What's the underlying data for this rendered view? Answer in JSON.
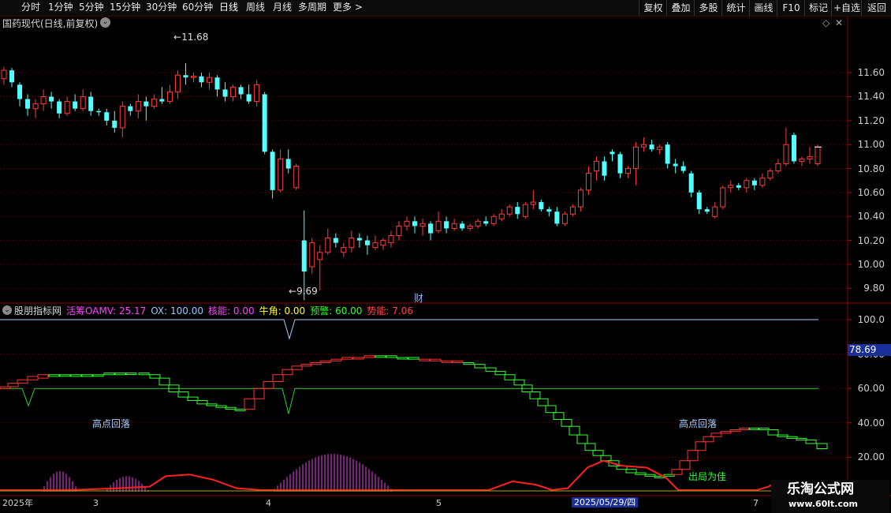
{
  "toolbar": {
    "left_items": [
      "分时",
      "1分钟",
      "5分钟",
      "15分钟",
      "30分钟",
      "60分钟",
      "日线",
      "周线",
      "月线",
      "多周期",
      "更多 >"
    ],
    "active_item": "日线",
    "right_items": [
      "复权",
      "叠加",
      "多股",
      "统计",
      "画线",
      "F10",
      "标记",
      "+自选",
      "返回"
    ]
  },
  "price_panel": {
    "title": "国药现代(日线,前复权)",
    "high_label": "11.68",
    "low_label": "9.69",
    "event_marker": "财",
    "axis_ticks": [
      "11.60",
      "11.40",
      "11.20",
      "11.00",
      "10.80",
      "10.60",
      "10.40",
      "10.20",
      "10.00",
      "9.80"
    ]
  },
  "indicator_panel": {
    "name": "股朋指标网",
    "readouts": [
      {
        "label": "活筹OAMV:",
        "value": "25.17",
        "color": "#ff44ff"
      },
      {
        "label": "OX:",
        "value": "100.00",
        "color": "#99c8ff"
      },
      {
        "label": "核能:",
        "value": "0.00",
        "color": "#ff44ff"
      },
      {
        "label": "牛角:",
        "value": "0.00",
        "color": "#ffff33"
      },
      {
        "label": "预警:",
        "value": "60.00",
        "color": "#33ff33"
      },
      {
        "label": "势能:",
        "value": "7.06",
        "color": "#ff4444"
      }
    ],
    "axis_ticks": [
      "100.0",
      "80.00",
      "60.00",
      "40.00",
      "20.00"
    ],
    "current_value": "78.69",
    "annotations": [
      "高点回落",
      "高点回落",
      "出局为佳"
    ]
  },
  "date_axis": {
    "labels": [
      "2025年",
      "3",
      "4",
      "5",
      "7"
    ],
    "cursor_date": "2025/05/29/四"
  },
  "watermark": {
    "line1": "乐淘公式网",
    "line2": "www.60lt.com"
  },
  "colors": {
    "up": "#ff3c3c",
    "down": "#54ffff",
    "bg": "#000000",
    "grid": "#5a0000"
  },
  "chart_data": {
    "type": "candlestick",
    "title": "国药现代(日线,前复权)",
    "ylim": [
      9.69,
      11.72
    ],
    "candles": [
      [
        11.55,
        11.65,
        11.5,
        11.62
      ],
      [
        11.62,
        11.64,
        11.48,
        11.52
      ],
      [
        11.5,
        11.52,
        11.32,
        11.38
      ],
      [
        11.38,
        11.42,
        11.24,
        11.3
      ],
      [
        11.3,
        11.38,
        11.22,
        11.34
      ],
      [
        11.34,
        11.46,
        11.28,
        11.4
      ],
      [
        11.4,
        11.44,
        11.3,
        11.36
      ],
      [
        11.36,
        11.38,
        11.22,
        11.26
      ],
      [
        11.26,
        11.4,
        11.24,
        11.36
      ],
      [
        11.36,
        11.42,
        11.28,
        11.3
      ],
      [
        11.3,
        11.46,
        11.28,
        11.4
      ],
      [
        11.4,
        11.44,
        11.24,
        11.28
      ],
      [
        11.28,
        11.3,
        11.24,
        11.27
      ],
      [
        11.27,
        11.3,
        11.16,
        11.2
      ],
      [
        11.2,
        11.28,
        11.1,
        11.14
      ],
      [
        11.14,
        11.36,
        11.06,
        11.32
      ],
      [
        11.32,
        11.34,
        11.24,
        11.28
      ],
      [
        11.28,
        11.42,
        11.22,
        11.36
      ],
      [
        11.36,
        11.4,
        11.2,
        11.32
      ],
      [
        11.32,
        11.42,
        11.3,
        11.38
      ],
      [
        11.38,
        11.48,
        11.34,
        11.36
      ],
      [
        11.36,
        11.5,
        11.34,
        11.44
      ],
      [
        11.44,
        11.62,
        11.38,
        11.58
      ],
      [
        11.58,
        11.68,
        11.5,
        11.56
      ],
      [
        11.56,
        11.6,
        11.52,
        11.57
      ],
      [
        11.57,
        11.6,
        11.48,
        11.52
      ],
      [
        11.52,
        11.6,
        11.46,
        11.56
      ],
      [
        11.56,
        11.58,
        11.4,
        11.46
      ],
      [
        11.46,
        11.52,
        11.36,
        11.4
      ],
      [
        11.4,
        11.5,
        11.36,
        11.48
      ],
      [
        11.48,
        11.5,
        11.38,
        11.42
      ],
      [
        11.42,
        11.5,
        11.34,
        11.36
      ],
      [
        11.36,
        11.54,
        11.32,
        11.5
      ],
      [
        11.42,
        11.44,
        10.92,
        10.94
      ],
      [
        10.94,
        10.96,
        10.55,
        10.62
      ],
      [
        10.62,
        10.96,
        10.6,
        10.88
      ],
      [
        10.88,
        10.96,
        10.76,
        10.8
      ],
      [
        10.64,
        10.84,
        10.62,
        10.82
      ],
      [
        10.2,
        10.45,
        9.7,
        9.94
      ],
      [
        9.98,
        10.22,
        9.92,
        10.18
      ],
      [
        10.04,
        10.16,
        9.78,
        10.1
      ],
      [
        10.1,
        10.3,
        10.08,
        10.22
      ],
      [
        10.22,
        10.26,
        10.14,
        10.18
      ],
      [
        10.1,
        10.18,
        10.06,
        10.14
      ],
      [
        10.14,
        10.28,
        10.1,
        10.22
      ],
      [
        10.22,
        10.26,
        10.14,
        10.2
      ],
      [
        10.2,
        10.24,
        10.08,
        10.16
      ],
      [
        10.14,
        10.24,
        10.12,
        10.18
      ],
      [
        10.16,
        10.22,
        10.12,
        10.2
      ],
      [
        10.18,
        10.28,
        10.14,
        10.24
      ],
      [
        10.24,
        10.36,
        10.2,
        10.32
      ],
      [
        10.32,
        10.4,
        10.28,
        10.36
      ],
      [
        10.36,
        10.4,
        10.26,
        10.32
      ],
      [
        10.32,
        10.38,
        10.24,
        10.34
      ],
      [
        10.34,
        10.36,
        10.2,
        10.26
      ],
      [
        10.28,
        10.44,
        10.26,
        10.36
      ],
      [
        10.36,
        10.4,
        10.26,
        10.3
      ],
      [
        10.3,
        10.38,
        10.28,
        10.34
      ],
      [
        10.34,
        10.36,
        10.28,
        10.3
      ],
      [
        10.3,
        10.34,
        10.28,
        10.32
      ],
      [
        10.32,
        10.38,
        10.3,
        10.36
      ],
      [
        10.36,
        10.4,
        10.32,
        10.34
      ],
      [
        10.34,
        10.42,
        10.32,
        10.4
      ],
      [
        10.38,
        10.46,
        10.36,
        10.42
      ],
      [
        10.42,
        10.5,
        10.4,
        10.48
      ],
      [
        10.48,
        10.52,
        10.38,
        10.42
      ],
      [
        10.4,
        10.52,
        10.38,
        10.5
      ],
      [
        10.5,
        10.62,
        10.46,
        10.52
      ],
      [
        10.52,
        10.54,
        10.44,
        10.46
      ],
      [
        10.46,
        10.48,
        10.4,
        10.44
      ],
      [
        10.44,
        10.48,
        10.32,
        10.34
      ],
      [
        10.34,
        10.44,
        10.32,
        10.42
      ],
      [
        10.42,
        10.5,
        10.4,
        10.48
      ],
      [
        10.48,
        10.64,
        10.44,
        10.62
      ],
      [
        10.62,
        10.82,
        10.58,
        10.76
      ],
      [
        10.78,
        10.9,
        10.7,
        10.86
      ],
      [
        10.86,
        10.9,
        10.7,
        10.74
      ],
      [
        10.94,
        10.96,
        10.86,
        10.92
      ],
      [
        10.92,
        10.94,
        10.72,
        10.76
      ],
      [
        10.76,
        10.82,
        10.72,
        10.8
      ],
      [
        10.8,
        11.02,
        10.66,
        10.98
      ],
      [
        10.98,
        11.06,
        10.94,
        11.0
      ],
      [
        11.0,
        11.04,
        10.94,
        10.96
      ],
      [
        10.96,
        11.0,
        10.92,
        10.98
      ],
      [
        11.0,
        11.02,
        10.8,
        10.84
      ],
      [
        10.84,
        10.88,
        10.76,
        10.82
      ],
      [
        10.82,
        10.86,
        10.76,
        10.78
      ],
      [
        10.76,
        10.78,
        10.56,
        10.6
      ],
      [
        10.6,
        10.62,
        10.42,
        10.46
      ],
      [
        10.46,
        10.48,
        10.42,
        10.44
      ],
      [
        10.4,
        10.52,
        10.38,
        10.48
      ],
      [
        10.48,
        10.66,
        10.46,
        10.64
      ],
      [
        10.64,
        10.7,
        10.6,
        10.66
      ],
      [
        10.66,
        10.68,
        10.62,
        10.64
      ],
      [
        10.64,
        10.72,
        10.6,
        10.7
      ],
      [
        10.7,
        10.72,
        10.62,
        10.66
      ],
      [
        10.66,
        10.76,
        10.64,
        10.72
      ],
      [
        10.72,
        10.8,
        10.7,
        10.78
      ],
      [
        10.78,
        10.88,
        10.76,
        10.84
      ],
      [
        10.84,
        11.14,
        10.82,
        11.0
      ],
      [
        11.08,
        11.1,
        10.84,
        10.86
      ],
      [
        10.86,
        10.9,
        10.82,
        10.88
      ],
      [
        10.88,
        10.98,
        10.84,
        10.9
      ],
      [
        10.84,
        11.0,
        10.82,
        10.98
      ]
    ]
  }
}
